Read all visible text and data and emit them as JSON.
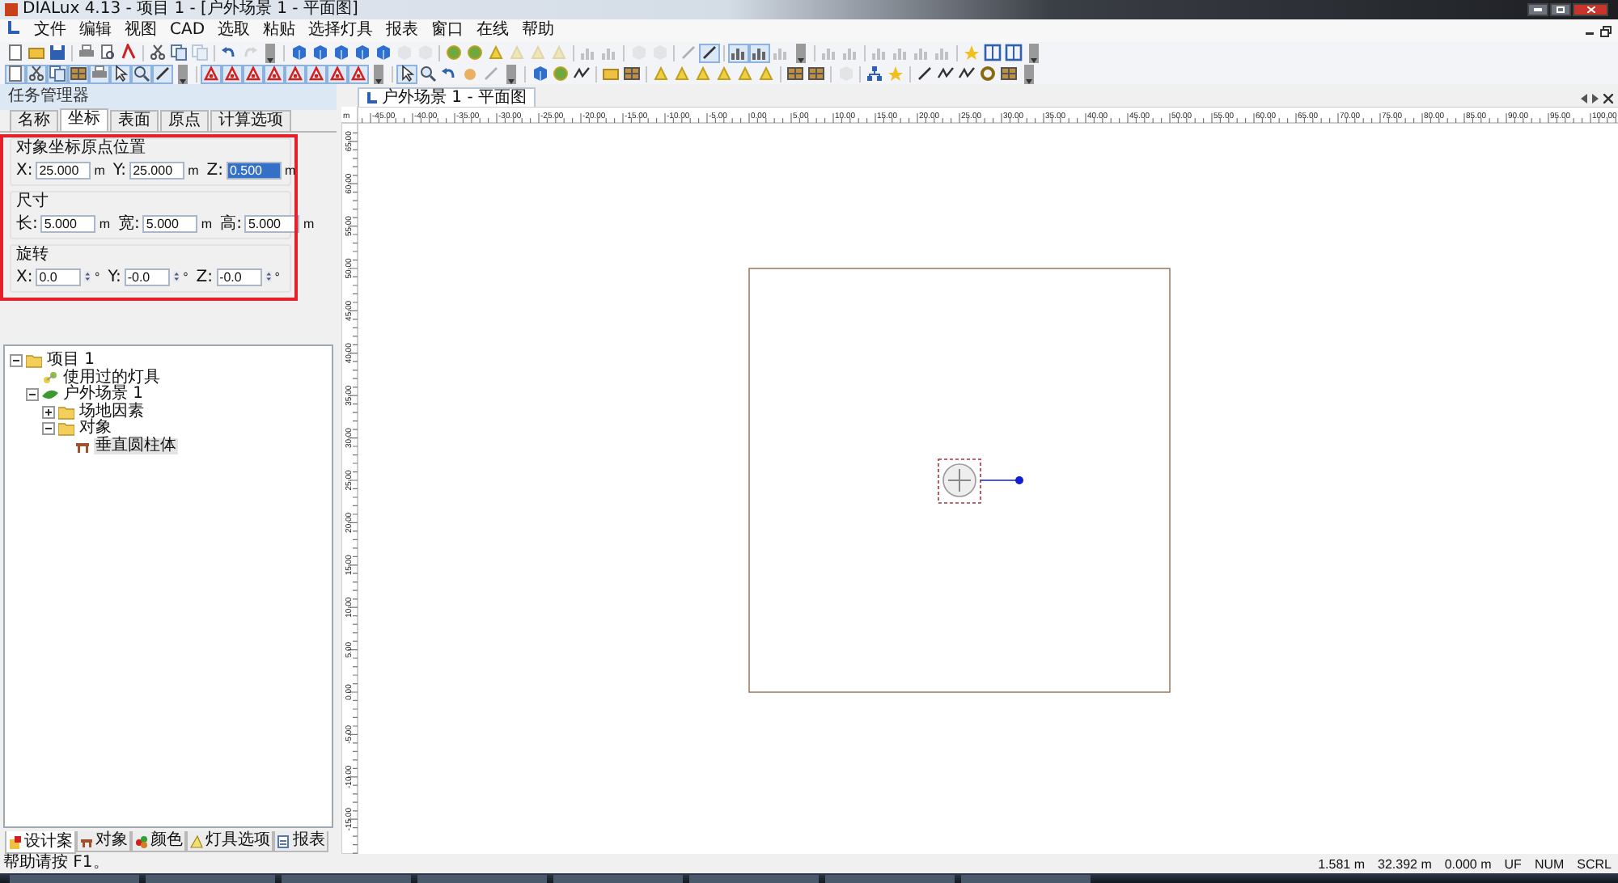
{
  "window": {
    "title": "DIALux 4.13 - 项目 1 - [户外场景 1 - 平面图]"
  },
  "menu": [
    "文件",
    "编辑",
    "视图",
    "CAD",
    "选取",
    "粘贴",
    "选择灯具",
    "报表",
    "窗口",
    "在线",
    "帮助"
  ],
  "task_manager": {
    "title": "任务管理器",
    "tabs": [
      {
        "label": "名称",
        "selected": false
      },
      {
        "label": "坐标",
        "selected": true
      },
      {
        "label": "表面",
        "selected": false
      },
      {
        "label": "原点",
        "selected": false
      },
      {
        "label": "计算选项",
        "selected": false
      }
    ],
    "groups": [
      {
        "title": "对象坐标原点位置",
        "fields": [
          {
            "kind": "text",
            "label": "X:",
            "value": "25.000",
            "unit": "m",
            "selected": false
          },
          {
            "kind": "text",
            "label": "Y:",
            "value": "25.000",
            "unit": "m",
            "selected": false
          },
          {
            "kind": "text",
            "label": "Z:",
            "value": "0.500",
            "unit": "m",
            "selected": true
          }
        ]
      },
      {
        "title": "尺寸",
        "fields": [
          {
            "kind": "text",
            "label": "长:",
            "value": "5.000",
            "unit": "m",
            "selected": false
          },
          {
            "kind": "text",
            "label": "宽:",
            "value": "5.000",
            "unit": "m",
            "selected": false
          },
          {
            "kind": "text",
            "label": "高:",
            "value": "5.000",
            "unit": "m",
            "selected": false
          }
        ]
      },
      {
        "title": "旋转",
        "fields": [
          {
            "kind": "spin",
            "label": "X:",
            "value": "0.0",
            "unit": "°",
            "selected": false
          },
          {
            "kind": "spin",
            "label": "Y:",
            "value": "-0.0",
            "unit": "°",
            "selected": false
          },
          {
            "kind": "spin",
            "label": "Z:",
            "value": "-0.0",
            "unit": "°",
            "selected": false
          }
        ]
      }
    ]
  },
  "tree": [
    {
      "label": "项目 1",
      "kind": "folder",
      "expanded": true,
      "selected": false,
      "children": [
        {
          "label": "使用过的灯具",
          "kind": "luminaires",
          "selected": false
        },
        {
          "label": "户外场景 1",
          "kind": "scene",
          "expanded": true,
          "selected": false,
          "children": [
            {
              "label": "场地因素",
              "kind": "folder",
              "expanded": false,
              "selected": false
            },
            {
              "label": "对象",
              "kind": "folder",
              "expanded": true,
              "selected": false,
              "children": [
                {
                  "label": "垂直圆柱体",
                  "kind": "object",
                  "selected": true
                }
              ]
            }
          ]
        }
      ]
    }
  ],
  "bottom_tabs": [
    {
      "label": "设计案",
      "kind": "project",
      "selected": true
    },
    {
      "label": "对象",
      "kind": "object",
      "selected": false
    },
    {
      "label": "颜色",
      "kind": "color",
      "selected": false
    },
    {
      "label": "灯具选项",
      "kind": "lamp",
      "selected": false
    },
    {
      "label": "报表",
      "kind": "report",
      "selected": false
    }
  ],
  "document": {
    "tab": "户外场景 1 - 平面图",
    "ruler_unit": "m",
    "x_ruler": [
      "-45.00",
      "-40.00",
      "-35.00",
      "-30.00",
      "-25.00",
      "-20.00",
      "-15.00",
      "-10.00",
      "-5.00",
      "0.00",
      "5.00",
      "10.00",
      "15.00",
      "20.00",
      "25.00",
      "30.00",
      "35.00",
      "40.00",
      "45.00",
      "50.00",
      "55.00",
      "60.00",
      "65.00",
      "70.00",
      "75.00",
      "80.00",
      "85.00",
      "90.00",
      "95.00",
      "100.00"
    ],
    "y_ruler": [
      "65.00",
      "60.00",
      "55.00",
      "50.00",
      "45.00",
      "40.00",
      "35.00",
      "30.00",
      "25.00",
      "20.00",
      "15.00",
      "10.00",
      "5.00",
      "0.00",
      "-5.00",
      "-10.00",
      "-15.00"
    ]
  },
  "status_bar": {
    "help": "帮助请按 F1。",
    "fields": [
      "1.581 m",
      "32.392 m",
      "0.000 m",
      "UF",
      "NUM",
      "SCRL"
    ]
  }
}
